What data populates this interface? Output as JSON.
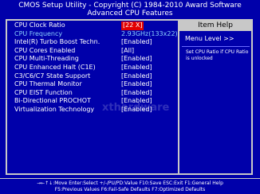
{
  "header": {
    "line1": "CMOS Setup Utility - Copyright (C) 1984-2010 Award Software",
    "line2": "Advanced CPU Features"
  },
  "settings": [
    {
      "label": "CPU Clock Ratio",
      "value": "[22 X]",
      "selected": true
    },
    {
      "label": "CPU Frequency",
      "value": "2.93GHz(133x22)",
      "dim": true
    },
    {
      "label": "Intel(R) Turbo Boost Techn.",
      "value": "[Enabled]"
    },
    {
      "label": "CPU Cores Enabled",
      "value": "[All]"
    },
    {
      "label": "CPU Multi-Threading",
      "value": "[Enabled]"
    },
    {
      "label": "CPU Enhanced Halt (C1E)",
      "value": "[Enabled]"
    },
    {
      "label": "C3/C6/C7 State Support",
      "value": "[Enabled]"
    },
    {
      "label": "CPU Thermal Monitor",
      "value": "[Enabled]"
    },
    {
      "label": "CPU EIST Function",
      "value": "[Enabled]"
    },
    {
      "label": "Bi-Directional PROCHOT",
      "value": "[Enabled]"
    },
    {
      "label": "Virtualization Technology",
      "value": "[Enabled]"
    }
  ],
  "help": {
    "title": "Item Help",
    "menu_level": "Menu Level  >>",
    "text": "Set CPU Ratio if CPU Ratio is unlocked"
  },
  "footer": {
    "line1": "→←↑↓:Move  Enter:Select  +/-/PU/PD:Value  F10:Save  ESC:Exit  F1:General Help",
    "line2": "F5:Previous Values   F6:Fail-Safe Defaults   F7:Optimized Defaults"
  },
  "watermark": "xthardware",
  "colors": {
    "background": "#0000aa",
    "selected": "#e30000",
    "frame": "#c8c8c8",
    "dim_text": "#8ad0ff"
  }
}
